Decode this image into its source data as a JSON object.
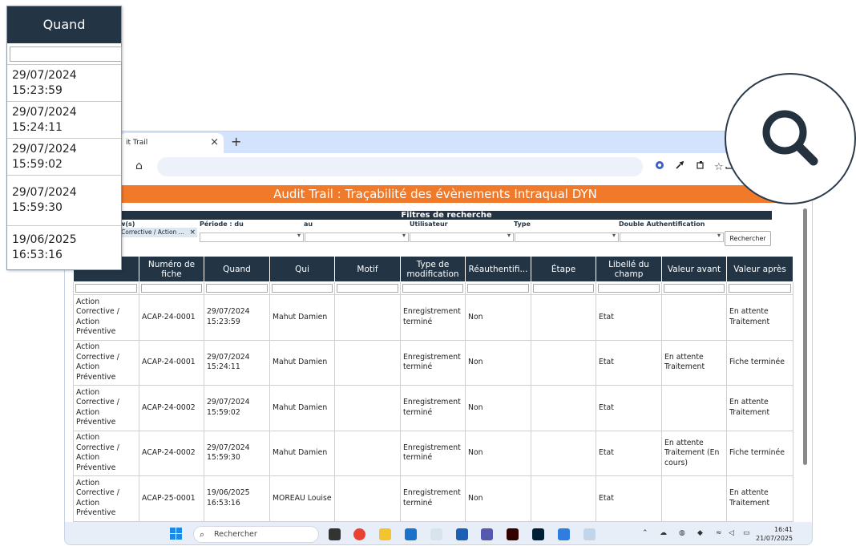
{
  "browser": {
    "tab_title": "it Trail",
    "tab_close": "×",
    "new_tab": "+"
  },
  "page": {
    "banner": "Audit Trail : Traçabilité des évènements Intraqual DYN",
    "filters_title": "Filtres de recherche",
    "filter_labels": {
      "workflow": "w(s)",
      "period_from": "Période : du",
      "period_to": "au",
      "user": "Utilisateur",
      "type": "Type",
      "double_auth": "Double Authentification"
    },
    "chip_text": "Corrective / Action ...",
    "chip_close": "×",
    "search_button": "Rechercher"
  },
  "table": {
    "headers": [
      "",
      "Numéro de fiche",
      "Quand",
      "Qui",
      "Motif",
      "Type de modification",
      "Réauthentifi...",
      "Étape",
      "Libellé du champ",
      "Valeur avant",
      "Valeur après"
    ],
    "rows": [
      [
        "Action Corrective / Action Préventive",
        "ACAP-24-0001",
        "29/07/2024 15:23:59",
        "Mahut Damien",
        "",
        "Enregistrement terminé",
        "Non",
        "",
        "Etat",
        "",
        "En attente Traitement"
      ],
      [
        "Action Corrective / Action Préventive",
        "ACAP-24-0001",
        "29/07/2024 15:24:11",
        "Mahut Damien",
        "",
        "Enregistrement terminé",
        "Non",
        "",
        "Etat",
        "En attente Traitement",
        "Fiche terminée"
      ],
      [
        "Action Corrective / Action Préventive",
        "ACAP-24-0002",
        "29/07/2024 15:59:02",
        "Mahut Damien",
        "",
        "Enregistrement terminé",
        "Non",
        "",
        "Etat",
        "",
        "En attente Traitement"
      ],
      [
        "Action Corrective / Action Préventive",
        "ACAP-24-0002",
        "29/07/2024 15:59:30",
        "Mahut Damien",
        "",
        "Enregistrement terminé",
        "Non",
        "",
        "Etat",
        "En attente Traitement (En cours)",
        "Fiche terminée"
      ],
      [
        "Action Corrective / Action Préventive",
        "ACAP-25-0001",
        "19/06/2025 16:53:16",
        "MOREAU Louise",
        "",
        "Enregistrement terminé",
        "Non",
        "",
        "Etat",
        "",
        "En attente Traitement"
      ]
    ]
  },
  "zoom": {
    "header": "Quand",
    "cells": [
      [
        "29/07/2024",
        "15:23:59"
      ],
      [
        "29/07/2024",
        "15:24:11"
      ],
      [
        "29/07/2024",
        "15:59:02"
      ],
      [
        "29/07/2024",
        "15:59:30"
      ],
      [
        "19/06/2025",
        "16:53:16"
      ]
    ]
  },
  "taskbar": {
    "search_placeholder": "Rechercher",
    "time": "16:41",
    "date": "21/07/2025"
  },
  "colors": {
    "banner": "#f07a2a",
    "header_dark": "#233545",
    "tab_strip": "#d3e3fd"
  }
}
